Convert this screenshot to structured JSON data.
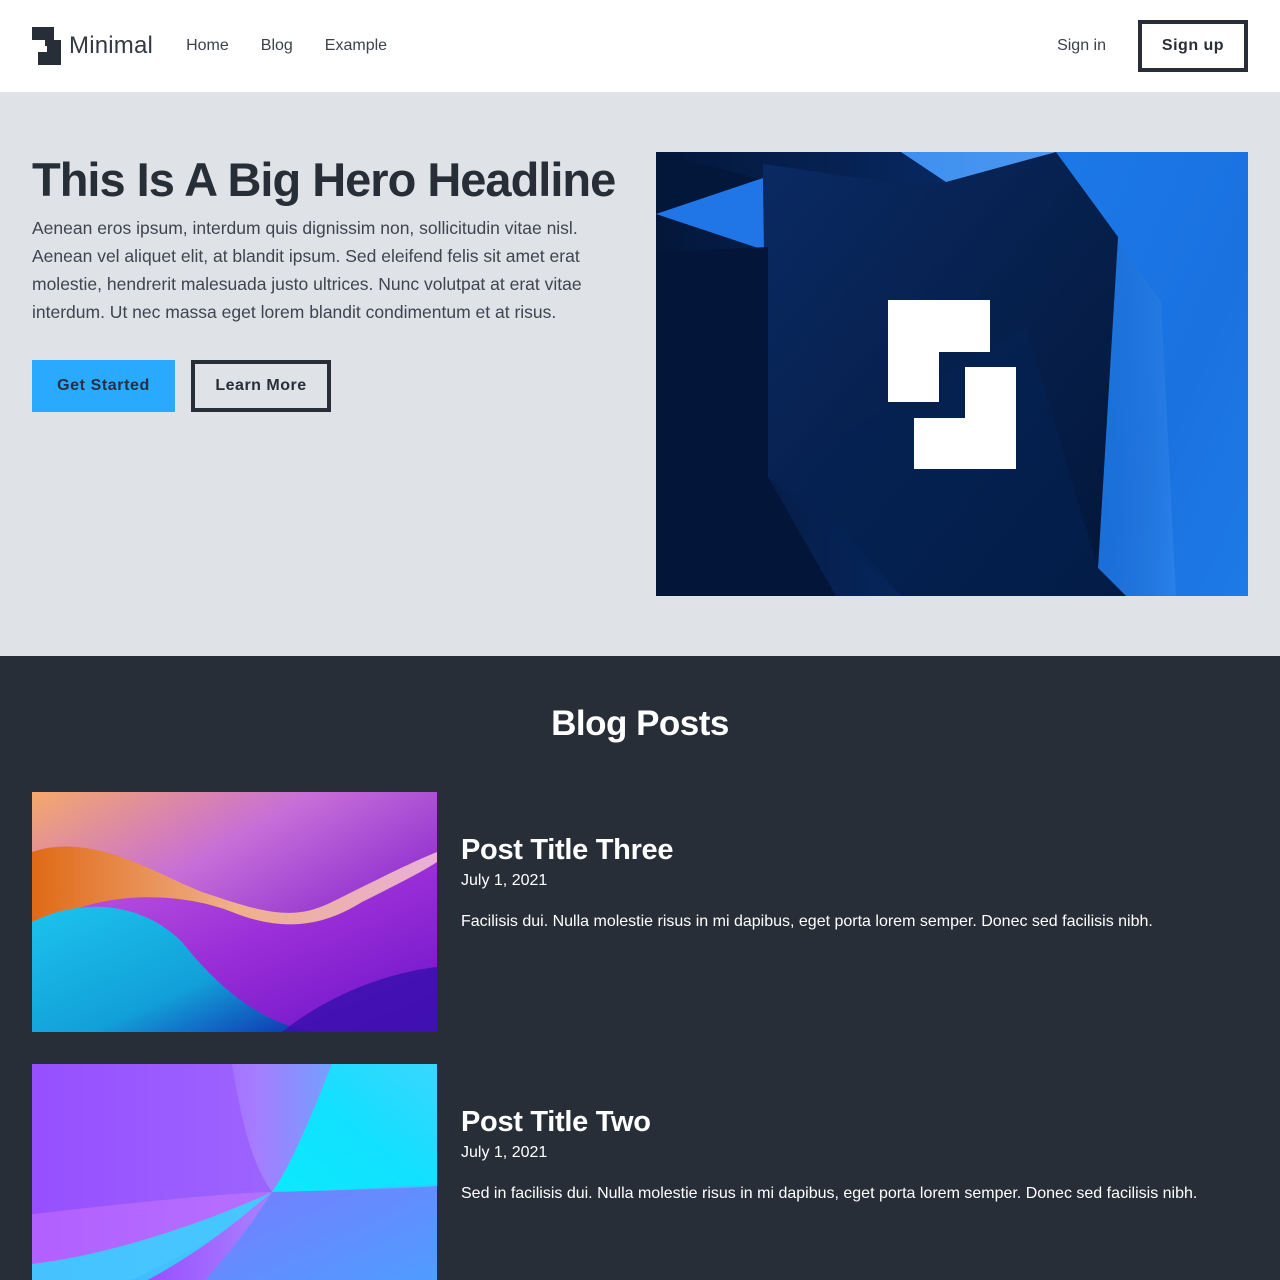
{
  "nav": {
    "brand": "Minimal",
    "links": [
      "Home",
      "Blog",
      "Example"
    ],
    "sign_in": "Sign in",
    "sign_up": "Sign up"
  },
  "hero": {
    "headline": "This Is A Big Hero Headline",
    "body": "Aenean eros ipsum, interdum quis dignissim non, sollicitudin vitae nisl. Aenean vel aliquet elit, at blandit ipsum. Sed eleifend felis sit amet erat molestie, hendrerit malesuada justo ultrices. Nunc volutpat at erat vitae interdum. Ut nec massa eget lorem blandit condimentum et at risus.",
    "primary_cta": "Get Started",
    "secondary_cta": "Learn More"
  },
  "blog": {
    "title": "Blog Posts",
    "posts": [
      {
        "title": "Post Title Three",
        "date": "July 1, 2021",
        "excerpt": "Facilisis dui. Nulla molestie risus in mi dapibus, eget porta lorem semper. Donec sed facilisis nibh."
      },
      {
        "title": "Post Title Two",
        "date": "July 1, 2021",
        "excerpt": "Sed in facilisis dui. Nulla molestie risus in mi dapibus, eget porta lorem semper. Donec sed facilisis nibh."
      }
    ]
  },
  "colors": {
    "primary": "#2aaaff",
    "dark": "#282e37",
    "hero_bg": "#dfe2e7",
    "hero_image_blue": "#1f7ae8"
  },
  "icons": {
    "brand_logo": "logo-mark-icon",
    "hero_logo": "logo-mark-icon"
  }
}
